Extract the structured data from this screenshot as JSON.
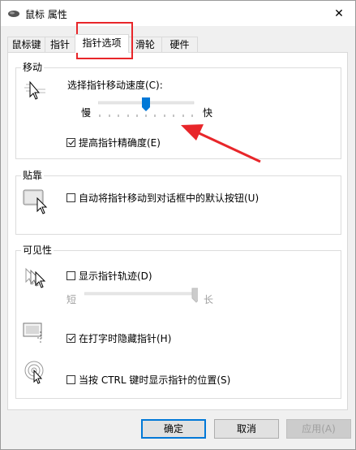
{
  "window": {
    "title": "鼠标 属性",
    "close_glyph": "✕"
  },
  "tabs": [
    {
      "label": "鼠标键",
      "active": false
    },
    {
      "label": "指针",
      "active": false
    },
    {
      "label": "指针选项",
      "active": true
    },
    {
      "label": "滑轮",
      "active": false
    },
    {
      "label": "硬件",
      "active": false
    }
  ],
  "motion": {
    "group_label": "移动",
    "speed_label": "选择指针移动速度(C):",
    "slow_label": "慢",
    "fast_label": "快",
    "speed_value_fraction": 0.5,
    "precision_label": "提高指针精确度(E)",
    "precision_checked": true
  },
  "snap": {
    "group_label": "贴靠",
    "snap_label": "自动将指针移动到对话框中的默认按钮(U)",
    "snap_checked": false
  },
  "visibility": {
    "group_label": "可见性",
    "trails_label": "显示指针轨迹(D)",
    "trails_checked": false,
    "short_label": "短",
    "long_label": "长",
    "trails_value_fraction": 1.0,
    "hide_label": "在打字时隐藏指针(H)",
    "hide_checked": true,
    "ctrl_label": "当按 CTRL 键时显示指针的位置(S)",
    "ctrl_checked": false
  },
  "buttons": {
    "ok": "确定",
    "cancel": "取消",
    "apply": "应用(A)"
  },
  "annotation_color": "#e8262a",
  "accent_color": "#0078d7"
}
